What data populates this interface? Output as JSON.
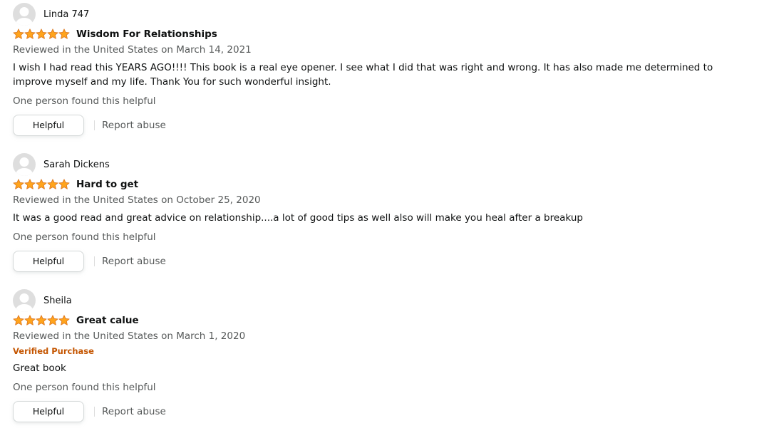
{
  "colors": {
    "star": "#ffa41c",
    "star_outline": "#de7921",
    "verified": "#c45500",
    "secondary_text": "#565959",
    "primary_text": "#0f1111"
  },
  "icons": {
    "avatar": "default-user-avatar-icon",
    "star": "star-icon"
  },
  "reviews": [
    {
      "profile_name": "Linda 747",
      "rating": 5,
      "rating_max": 5,
      "title": "Wisdom For Relationships",
      "date": "Reviewed in the United States on March 14, 2021",
      "verified": "",
      "body": "I wish I had read this YEARS AGO!!!! This book is a real eye opener. I see what I did that was right and wrong. It has also made me determined to improve myself and my life. Thank You for such wonderful insight.",
      "helpful_count": "One person found this helpful",
      "helpful_label": "Helpful",
      "report_label": "Report abuse"
    },
    {
      "profile_name": "Sarah Dickens",
      "rating": 5,
      "rating_max": 5,
      "title": "Hard to get",
      "date": "Reviewed in the United States on October 25, 2020",
      "verified": "",
      "body": "It was a good read and great advice on relationship....a lot of good tips as well also will make you heal after a breakup",
      "helpful_count": "One person found this helpful",
      "helpful_label": "Helpful",
      "report_label": "Report abuse"
    },
    {
      "profile_name": "Sheila",
      "rating": 5,
      "rating_max": 5,
      "title": "Great calue",
      "date": "Reviewed in the United States on March 1, 2020",
      "verified": "Verified Purchase",
      "body": "Great book",
      "helpful_count": "One person found this helpful",
      "helpful_label": "Helpful",
      "report_label": "Report abuse"
    }
  ]
}
